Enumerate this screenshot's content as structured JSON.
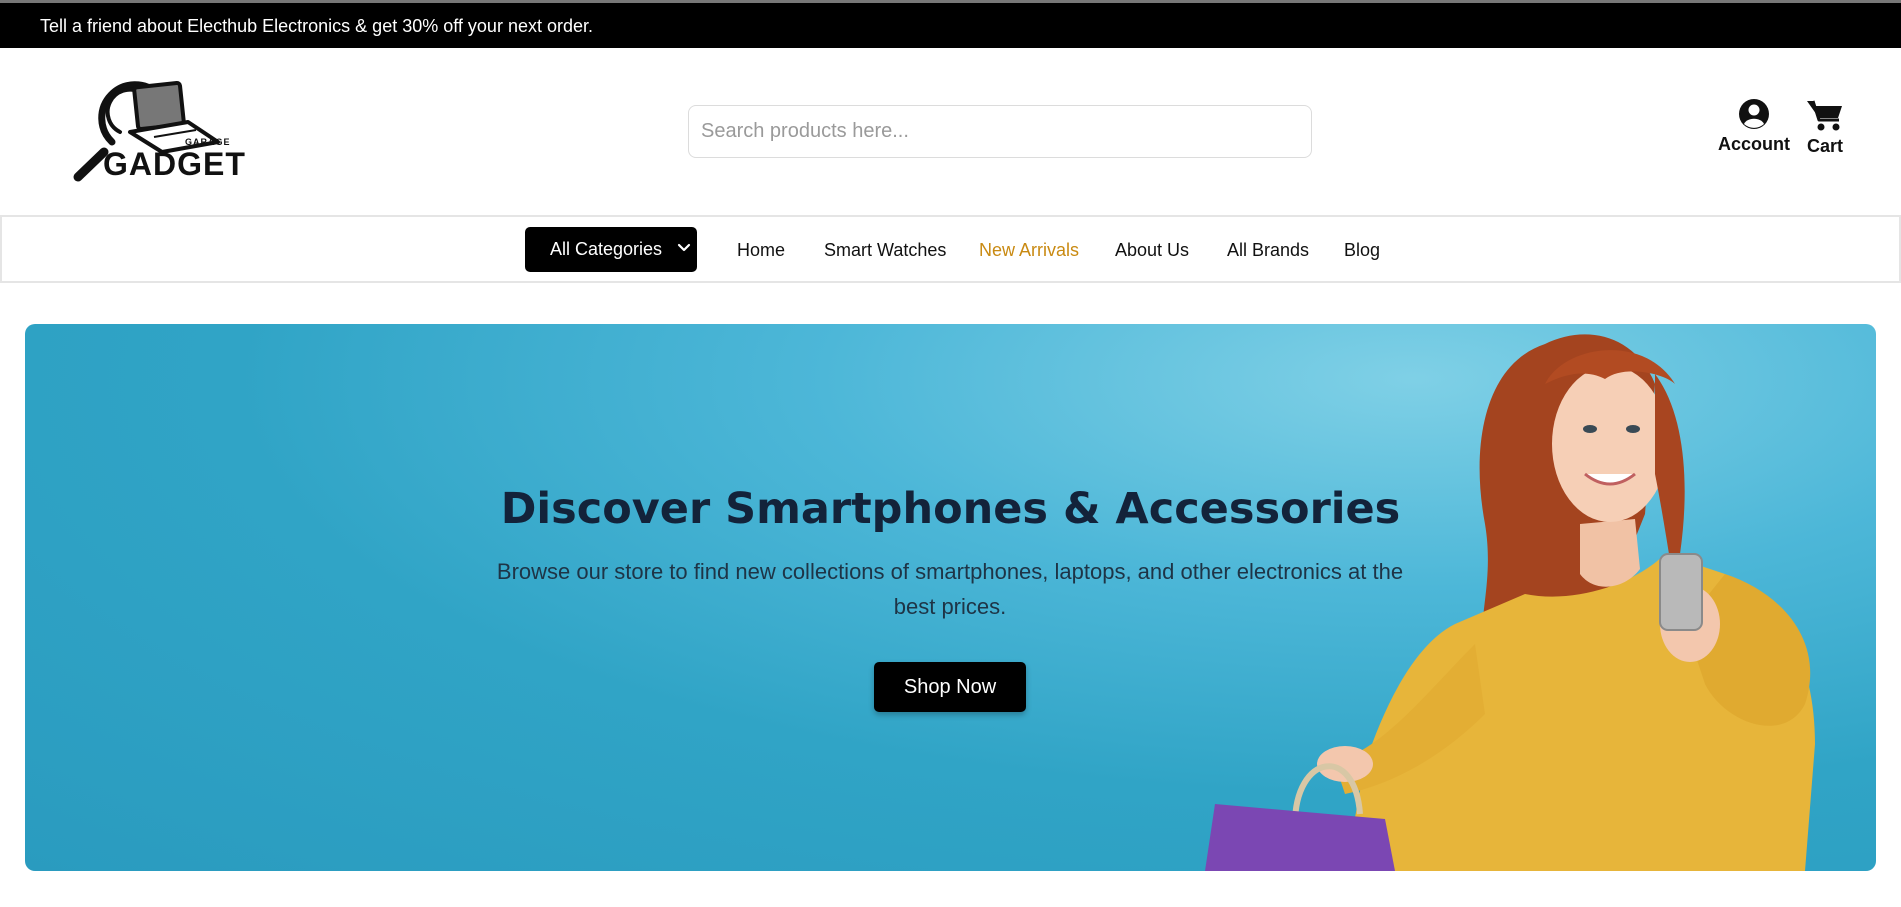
{
  "announcement": "Tell a friend about Electhub Electronics & get 30% off your next order.",
  "logo": {
    "word": "GADGET",
    "tagline": "GARAGE",
    "icon": "magnifier-laptop-logo"
  },
  "search": {
    "placeholder": "Search products here...",
    "value": ""
  },
  "header_actions": {
    "account": {
      "label": "Account",
      "icon": "user-circle-icon"
    },
    "cart": {
      "label": "Cart",
      "icon": "cart-icon"
    }
  },
  "nav": {
    "category_button": "All Categories",
    "links": [
      "Home",
      "Smart Watches",
      "New Arrivals",
      "About Us",
      "All Brands",
      "Blog"
    ],
    "active_index": 2
  },
  "hero": {
    "title": "Discover Smartphones & Accessories",
    "subtitle": "Browse our store to find new collections of smartphones, laptops, and other electronics at the best prices.",
    "cta": "Shop Now"
  },
  "colors": {
    "topbar_bg": "#000000",
    "active_nav": "#c98a12",
    "hero_bg": "#2fa3c6",
    "button_bg": "#000000"
  }
}
